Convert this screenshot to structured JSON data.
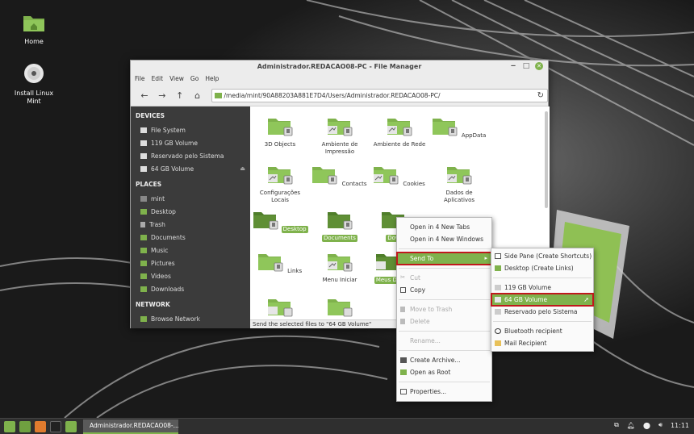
{
  "desktop": {
    "icons": [
      {
        "label": "Home"
      },
      {
        "label": "Install Linux Mint"
      }
    ]
  },
  "window": {
    "title": "Administrador.REDACAO08-PC - File Manager",
    "menus": [
      "File",
      "Edit",
      "View",
      "Go",
      "Help"
    ],
    "path": "/media/mint/90A88203A881E7D4/Users/Administrador.REDACAO08-PC/",
    "status": "Send the selected files to \"64 GB Volume\""
  },
  "sidebar": {
    "devices_heading": "DEVICES",
    "devices": [
      "File System",
      "119 GB Volume",
      "Reservado pelo Sistema",
      "64 GB Volume"
    ],
    "places_heading": "PLACES",
    "places": [
      "mint",
      "Desktop",
      "Trash",
      "Documents",
      "Music",
      "Pictures",
      "Videos",
      "Downloads"
    ],
    "network_heading": "NETWORK",
    "network": [
      "Browse Network"
    ]
  },
  "files": [
    {
      "name": "3D Objects"
    },
    {
      "name": "Ambiente de Impressão"
    },
    {
      "name": "Ambiente de Rede"
    },
    {
      "name": "AppData"
    },
    {
      "name": "Configurações Locais"
    },
    {
      "name": "Contacts"
    },
    {
      "name": "Cookies"
    },
    {
      "name": "Dados de Aplicativos"
    },
    {
      "name": "Desktop"
    },
    {
      "name": "Documents"
    },
    {
      "name": "Dow"
    },
    {
      "name": "Links"
    },
    {
      "name": "Menu Iniciar"
    },
    {
      "name": "Meus Do"
    }
  ],
  "context_menu": {
    "items": [
      "Open in 4 New Tabs",
      "Open in 4 New Windows",
      "Send To",
      "Cut",
      "Copy",
      "Move to Trash",
      "Delete",
      "Rename...",
      "Create Archive...",
      "Open as Root",
      "Properties..."
    ]
  },
  "send_to_menu": {
    "items": [
      "Side Pane (Create Shortcuts)",
      "Desktop (Create Links)",
      "119 GB Volume",
      "64 GB Volume",
      "Reservado pelo Sistema",
      "Bluetooth recipient",
      "Mail Recipient"
    ]
  },
  "taskbar": {
    "window_label": "Administrador.REDACAO08-...",
    "clock": "11:11"
  },
  "colors": {
    "accent": "#7fb24c",
    "highlight_box": "#c0181c"
  }
}
